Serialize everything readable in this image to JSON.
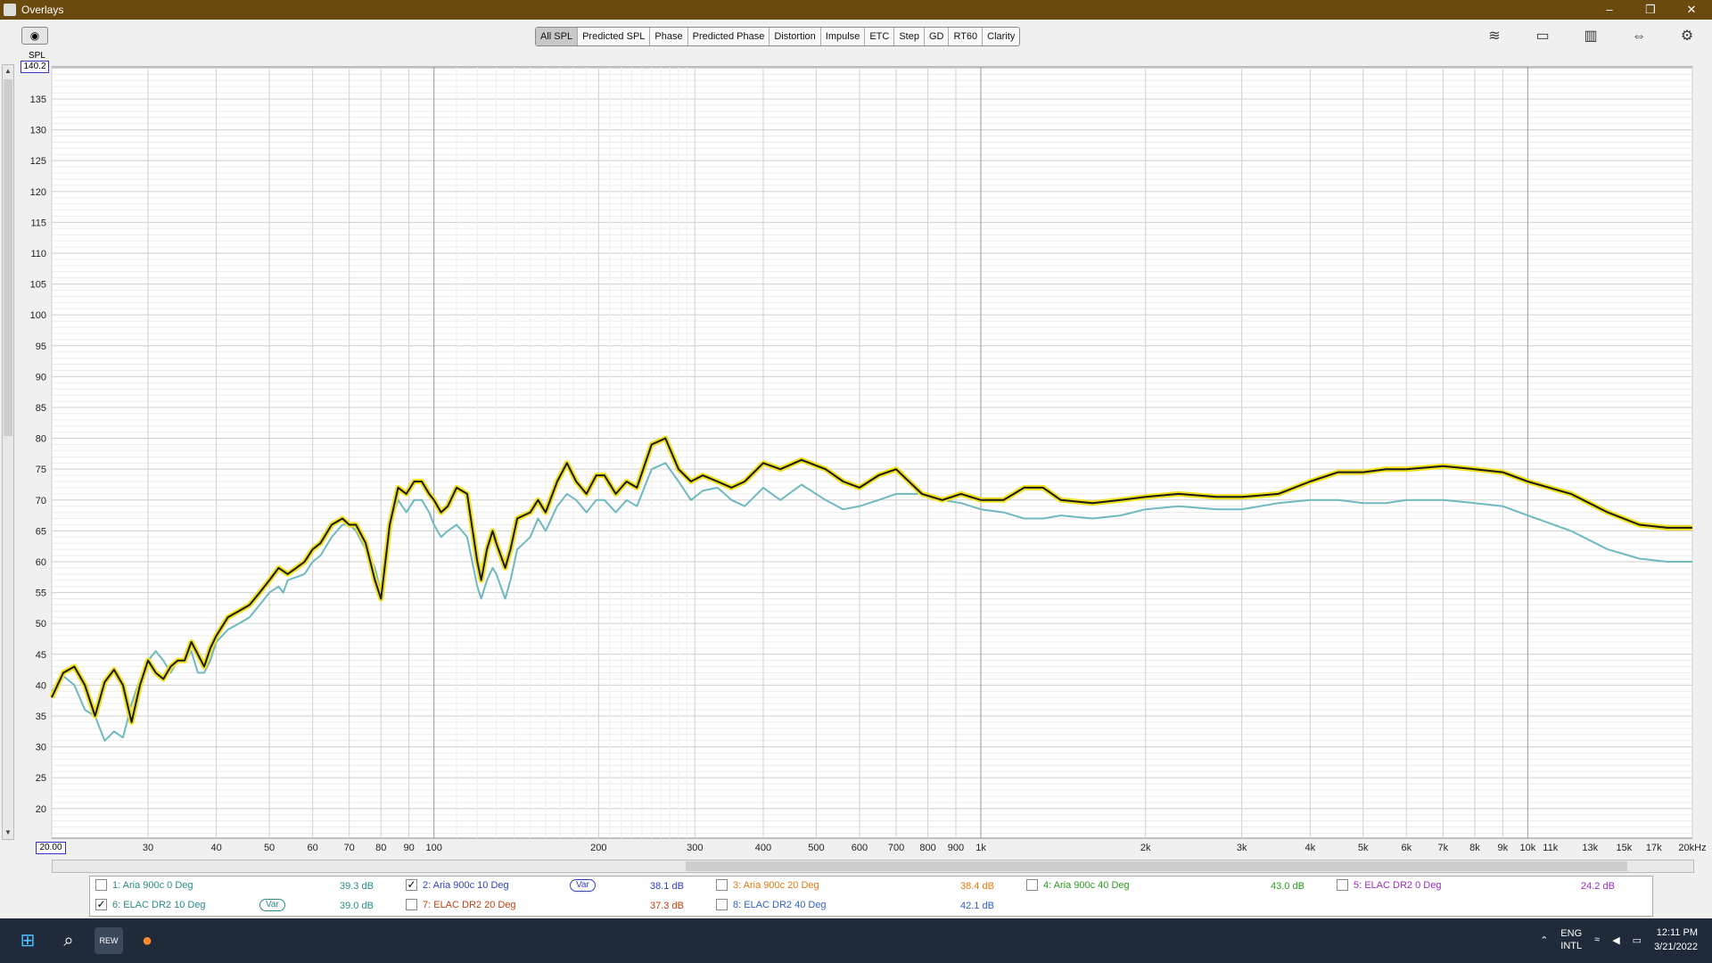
{
  "window": {
    "title": "Overlays",
    "controls": [
      "–",
      "❐",
      "✕"
    ]
  },
  "tabs": [
    {
      "label": "All SPL",
      "active": true
    },
    {
      "label": "Predicted SPL"
    },
    {
      "label": "Phase"
    },
    {
      "label": "Predicted Phase"
    },
    {
      "label": "Distortion"
    },
    {
      "label": "Impulse"
    },
    {
      "label": "ETC"
    },
    {
      "label": "Step"
    },
    {
      "label": "GD"
    },
    {
      "label": "RT60"
    },
    {
      "label": "Clarity"
    }
  ],
  "axis": {
    "y_label": "SPL",
    "y_max_box": "140.2",
    "x_min_box": "20.00"
  },
  "chart_data": {
    "type": "line",
    "x_scale": "log",
    "xlim": [
      20,
      20000
    ],
    "ylim": [
      15.2,
      140.2
    ],
    "x_tick_labels": [
      {
        "f": 30,
        "label": "30"
      },
      {
        "f": 40,
        "label": "40"
      },
      {
        "f": 50,
        "label": "50"
      },
      {
        "f": 60,
        "label": "60"
      },
      {
        "f": 70,
        "label": "70"
      },
      {
        "f": 80,
        "label": "80"
      },
      {
        "f": 90,
        "label": "90"
      },
      {
        "f": 100,
        "label": "100"
      },
      {
        "f": 200,
        "label": "200"
      },
      {
        "f": 300,
        "label": "300"
      },
      {
        "f": 400,
        "label": "400"
      },
      {
        "f": 500,
        "label": "500"
      },
      {
        "f": 600,
        "label": "600"
      },
      {
        "f": 700,
        "label": "700"
      },
      {
        "f": 800,
        "label": "800"
      },
      {
        "f": 900,
        "label": "900"
      },
      {
        "f": 1000,
        "label": "1k"
      },
      {
        "f": 2000,
        "label": "2k"
      },
      {
        "f": 3000,
        "label": "3k"
      },
      {
        "f": 4000,
        "label": "4k"
      },
      {
        "f": 5000,
        "label": "5k"
      },
      {
        "f": 6000,
        "label": "6k"
      },
      {
        "f": 7000,
        "label": "7k"
      },
      {
        "f": 8000,
        "label": "8k"
      },
      {
        "f": 9000,
        "label": "9k"
      },
      {
        "f": 10000,
        "label": "10k"
      },
      {
        "f": 11000,
        "label": "11k"
      },
      {
        "f": 13000,
        "label": "13k"
      },
      {
        "f": 15000,
        "label": "15k"
      },
      {
        "f": 17000,
        "label": "17k"
      },
      {
        "f": 20000,
        "label": "20kHz"
      }
    ],
    "y_ticks": [
      20,
      25,
      30,
      35,
      40,
      45,
      50,
      55,
      60,
      65,
      70,
      75,
      80,
      85,
      90,
      95,
      100,
      105,
      110,
      115,
      120,
      125,
      130,
      135
    ],
    "grid": true,
    "series": [
      {
        "name": "6: ELAC DR2 10 Deg",
        "color": "#6fb8c0",
        "points": [
          [
            20,
            39
          ],
          [
            21,
            41.5
          ],
          [
            22,
            40
          ],
          [
            23,
            36
          ],
          [
            24,
            35
          ],
          [
            25,
            31
          ],
          [
            26,
            32.5
          ],
          [
            27,
            31.5
          ],
          [
            28,
            37
          ],
          [
            29,
            41
          ],
          [
            30,
            44
          ],
          [
            31,
            45.5
          ],
          [
            32,
            44
          ],
          [
            33,
            42
          ],
          [
            34,
            44
          ],
          [
            35,
            44
          ],
          [
            36,
            45.5
          ],
          [
            37,
            42
          ],
          [
            38,
            42
          ],
          [
            39,
            44
          ],
          [
            40,
            47
          ],
          [
            42,
            49
          ],
          [
            44,
            50
          ],
          [
            46,
            51
          ],
          [
            48,
            53
          ],
          [
            50,
            55
          ],
          [
            52,
            56
          ],
          [
            53,
            55
          ],
          [
            54,
            57
          ],
          [
            56,
            57.5
          ],
          [
            58,
            58
          ],
          [
            60,
            60
          ],
          [
            62,
            61
          ],
          [
            65,
            64
          ],
          [
            68,
            66
          ],
          [
            70,
            66
          ],
          [
            72,
            65
          ],
          [
            75,
            62
          ],
          [
            78,
            59
          ],
          [
            80,
            55
          ],
          [
            83,
            66
          ],
          [
            86,
            70
          ],
          [
            89,
            68
          ],
          [
            92,
            70
          ],
          [
            95,
            70
          ],
          [
            98,
            68
          ],
          [
            100,
            66
          ],
          [
            103,
            64
          ],
          [
            106,
            65
          ],
          [
            110,
            66
          ],
          [
            115,
            64
          ],
          [
            120,
            56
          ],
          [
            122,
            54
          ],
          [
            125,
            57
          ],
          [
            128,
            59
          ],
          [
            130,
            58
          ],
          [
            135,
            54
          ],
          [
            138,
            57
          ],
          [
            142,
            62
          ],
          [
            150,
            64
          ],
          [
            155,
            67
          ],
          [
            160,
            65
          ],
          [
            168,
            69
          ],
          [
            175,
            71
          ],
          [
            182,
            70
          ],
          [
            190,
            68
          ],
          [
            198,
            70
          ],
          [
            205,
            70
          ],
          [
            215,
            68
          ],
          [
            225,
            70
          ],
          [
            235,
            69
          ],
          [
            250,
            75
          ],
          [
            265,
            76
          ],
          [
            280,
            73
          ],
          [
            295,
            70
          ],
          [
            310,
            71.5
          ],
          [
            330,
            72
          ],
          [
            350,
            70
          ],
          [
            370,
            69
          ],
          [
            400,
            72
          ],
          [
            430,
            70
          ],
          [
            470,
            72.5
          ],
          [
            520,
            70
          ],
          [
            560,
            68.5
          ],
          [
            600,
            69
          ],
          [
            650,
            70
          ],
          [
            700,
            71
          ],
          [
            780,
            71
          ],
          [
            850,
            70
          ],
          [
            920,
            69.5
          ],
          [
            1000,
            68.5
          ],
          [
            1100,
            68
          ],
          [
            1200,
            67
          ],
          [
            1300,
            67
          ],
          [
            1400,
            67.5
          ],
          [
            1600,
            67
          ],
          [
            1800,
            67.5
          ],
          [
            2000,
            68.5
          ],
          [
            2300,
            69
          ],
          [
            2700,
            68.5
          ],
          [
            3000,
            68.5
          ],
          [
            3500,
            69.5
          ],
          [
            4000,
            70
          ],
          [
            4500,
            70
          ],
          [
            5000,
            69.5
          ],
          [
            5500,
            69.5
          ],
          [
            6000,
            70
          ],
          [
            7000,
            70
          ],
          [
            8000,
            69.5
          ],
          [
            9000,
            69
          ],
          [
            10000,
            67.5
          ],
          [
            12000,
            65
          ],
          [
            14000,
            62
          ],
          [
            16000,
            60.5
          ],
          [
            18000,
            60
          ],
          [
            20000,
            60
          ]
        ]
      },
      {
        "name": "2: Aria 900c 10 Deg",
        "color": "#1a1a1a",
        "highlight": "#f0e020",
        "points": [
          [
            20,
            38
          ],
          [
            21,
            42
          ],
          [
            22,
            43
          ],
          [
            23,
            40
          ],
          [
            24,
            35
          ],
          [
            25,
            40.5
          ],
          [
            26,
            42.5
          ],
          [
            27,
            40
          ],
          [
            28,
            34
          ],
          [
            29,
            40
          ],
          [
            30,
            44
          ],
          [
            31,
            42
          ],
          [
            32,
            41
          ],
          [
            33,
            43
          ],
          [
            34,
            44
          ],
          [
            35,
            44
          ],
          [
            36,
            47
          ],
          [
            37,
            45
          ],
          [
            38,
            43
          ],
          [
            39,
            46
          ],
          [
            40,
            48
          ],
          [
            42,
            51
          ],
          [
            44,
            52
          ],
          [
            46,
            53
          ],
          [
            48,
            55
          ],
          [
            50,
            57
          ],
          [
            52,
            59
          ],
          [
            54,
            58
          ],
          [
            56,
            59
          ],
          [
            58,
            60
          ],
          [
            60,
            62
          ],
          [
            62,
            63
          ],
          [
            65,
            66
          ],
          [
            68,
            67
          ],
          [
            70,
            66
          ],
          [
            72,
            66
          ],
          [
            75,
            63
          ],
          [
            78,
            57
          ],
          [
            80,
            54
          ],
          [
            83,
            66
          ],
          [
            86,
            72
          ],
          [
            89,
            71
          ],
          [
            92,
            73
          ],
          [
            95,
            73
          ],
          [
            98,
            71
          ],
          [
            100,
            70
          ],
          [
            103,
            68
          ],
          [
            106,
            69
          ],
          [
            110,
            72
          ],
          [
            115,
            71
          ],
          [
            120,
            60
          ],
          [
            122,
            57
          ],
          [
            125,
            62
          ],
          [
            128,
            65
          ],
          [
            130,
            63
          ],
          [
            135,
            59
          ],
          [
            138,
            62
          ],
          [
            142,
            67
          ],
          [
            150,
            68
          ],
          [
            155,
            70
          ],
          [
            160,
            68
          ],
          [
            168,
            73
          ],
          [
            175,
            76
          ],
          [
            182,
            73
          ],
          [
            190,
            71
          ],
          [
            198,
            74
          ],
          [
            205,
            74
          ],
          [
            215,
            71
          ],
          [
            225,
            73
          ],
          [
            235,
            72
          ],
          [
            250,
            79
          ],
          [
            265,
            80
          ],
          [
            280,
            75
          ],
          [
            295,
            73
          ],
          [
            310,
            74
          ],
          [
            330,
            73
          ],
          [
            350,
            72
          ],
          [
            370,
            73
          ],
          [
            400,
            76
          ],
          [
            430,
            75
          ],
          [
            470,
            76.5
          ],
          [
            520,
            75
          ],
          [
            560,
            73
          ],
          [
            600,
            72
          ],
          [
            650,
            74
          ],
          [
            700,
            75
          ],
          [
            780,
            71
          ],
          [
            850,
            70
          ],
          [
            920,
            71
          ],
          [
            1000,
            70
          ],
          [
            1100,
            70
          ],
          [
            1200,
            72
          ],
          [
            1300,
            72
          ],
          [
            1400,
            70
          ],
          [
            1600,
            69.5
          ],
          [
            1800,
            70
          ],
          [
            2000,
            70.5
          ],
          [
            2300,
            71
          ],
          [
            2700,
            70.5
          ],
          [
            3000,
            70.5
          ],
          [
            3500,
            71
          ],
          [
            4000,
            73
          ],
          [
            4500,
            74.5
          ],
          [
            5000,
            74.5
          ],
          [
            5500,
            75
          ],
          [
            6000,
            75
          ],
          [
            7000,
            75.5
          ],
          [
            8000,
            75
          ],
          [
            9000,
            74.5
          ],
          [
            10000,
            73
          ],
          [
            12000,
            71
          ],
          [
            14000,
            68
          ],
          [
            16000,
            66
          ],
          [
            18000,
            65.5
          ],
          [
            20000,
            65.5
          ]
        ]
      }
    ]
  },
  "legend": [
    [
      {
        "label": "1: Aria 900c 0 Deg",
        "checked": false,
        "value": "39.3 dB",
        "color": "#2a8a8a"
      },
      {
        "label": "2: Aria 900c 10 Deg",
        "checked": true,
        "value": "38.1 dB",
        "color": "#3040c0",
        "badge": "Var"
      },
      {
        "label": "3: Aria 900c 20 Deg",
        "checked": false,
        "value": "38.4 dB",
        "color": "#e07a10"
      },
      {
        "label": "4: Aria 900c 40 Deg",
        "checked": false,
        "value": "43.0 dB",
        "color": "#2a9a20"
      },
      {
        "label": "5: ELAC DR2 0 Deg",
        "checked": false,
        "value": "24.2 dB",
        "color": "#9a30c0"
      }
    ],
    [
      {
        "label": "6: ELAC DR2 10 Deg",
        "checked": true,
        "value": "39.0 dB",
        "color": "#2a8a8a",
        "badge": "Var"
      },
      {
        "label": "7: ELAC DR2 20 Deg",
        "checked": false,
        "value": "37.3 dB",
        "color": "#c04010"
      },
      {
        "label": "8: ELAC DR2 40 Deg",
        "checked": false,
        "value": "42.1 dB",
        "color": "#3060c0"
      }
    ]
  ],
  "taskbar": {
    "language": "ENG",
    "layout": "INTL",
    "time": "12:11 PM",
    "date": "3/21/2022",
    "rew_label": "REW"
  }
}
